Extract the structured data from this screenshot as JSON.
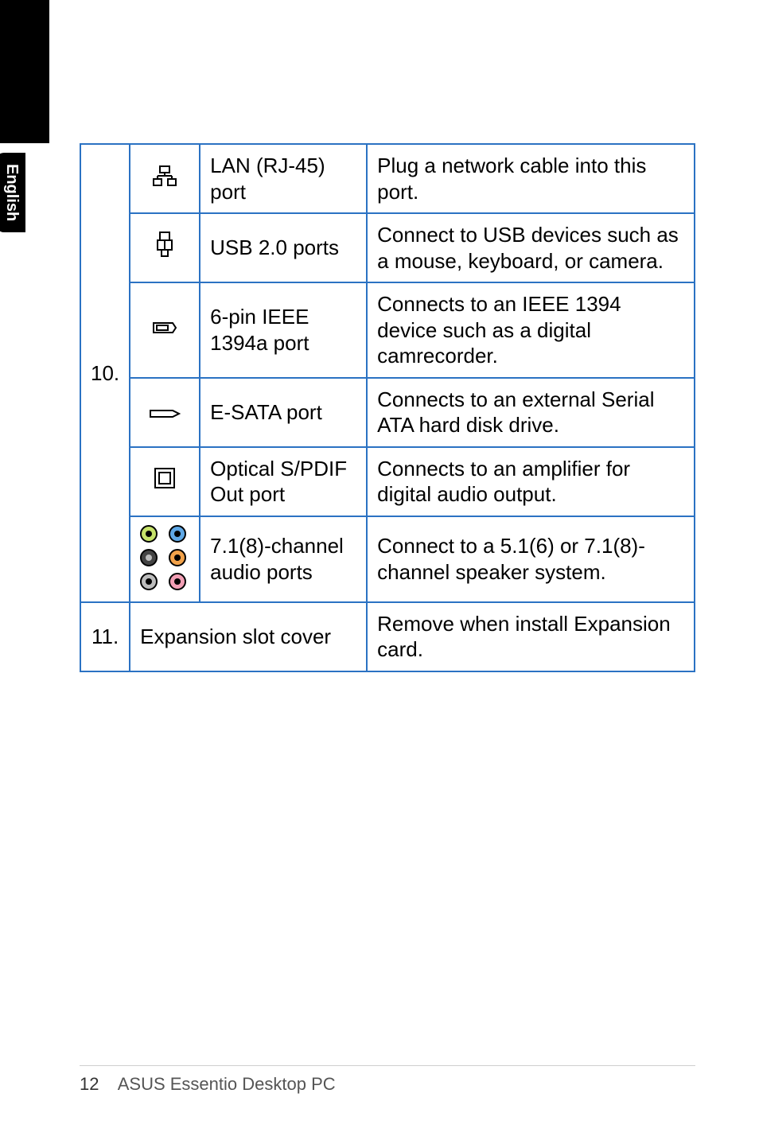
{
  "side_tab": "English",
  "rows": {
    "ten": {
      "num": "10.",
      "lan": {
        "icon_name": "lan-icon",
        "name": "LAN (RJ-45) port",
        "desc": "Plug a network cable into this port."
      },
      "usb": {
        "icon_name": "usb-icon",
        "name": "USB 2.0 ports",
        "desc": "Connect to USB devices such as a mouse, keyboard, or camera."
      },
      "ieee": {
        "icon_name": "ieee1394-icon",
        "name": "6-pin IEEE 1394a port",
        "desc": "Connects to an IEEE 1394 device such as a digital camrecorder."
      },
      "esata": {
        "icon_name": "esata-icon",
        "name": "E-SATA port",
        "desc": "Connects to an external Serial ATA hard disk drive."
      },
      "spdif": {
        "icon_name": "spdif-icon",
        "name": "Optical S/PDIF Out port",
        "desc": "Connects to an amplifier for digital audio output."
      },
      "audio": {
        "icon_name": "audio-jacks-icon",
        "name": "7.1(8)-channel audio ports",
        "desc": "Connect to a 5.1(6) or 7.1(8)-channel speaker system."
      }
    },
    "eleven": {
      "num": "11.",
      "name": "Expansion slot cover",
      "desc": "Remove when install Expansion card."
    }
  },
  "footer": {
    "page_num": "12",
    "title": "ASUS Essentio Desktop PC"
  }
}
